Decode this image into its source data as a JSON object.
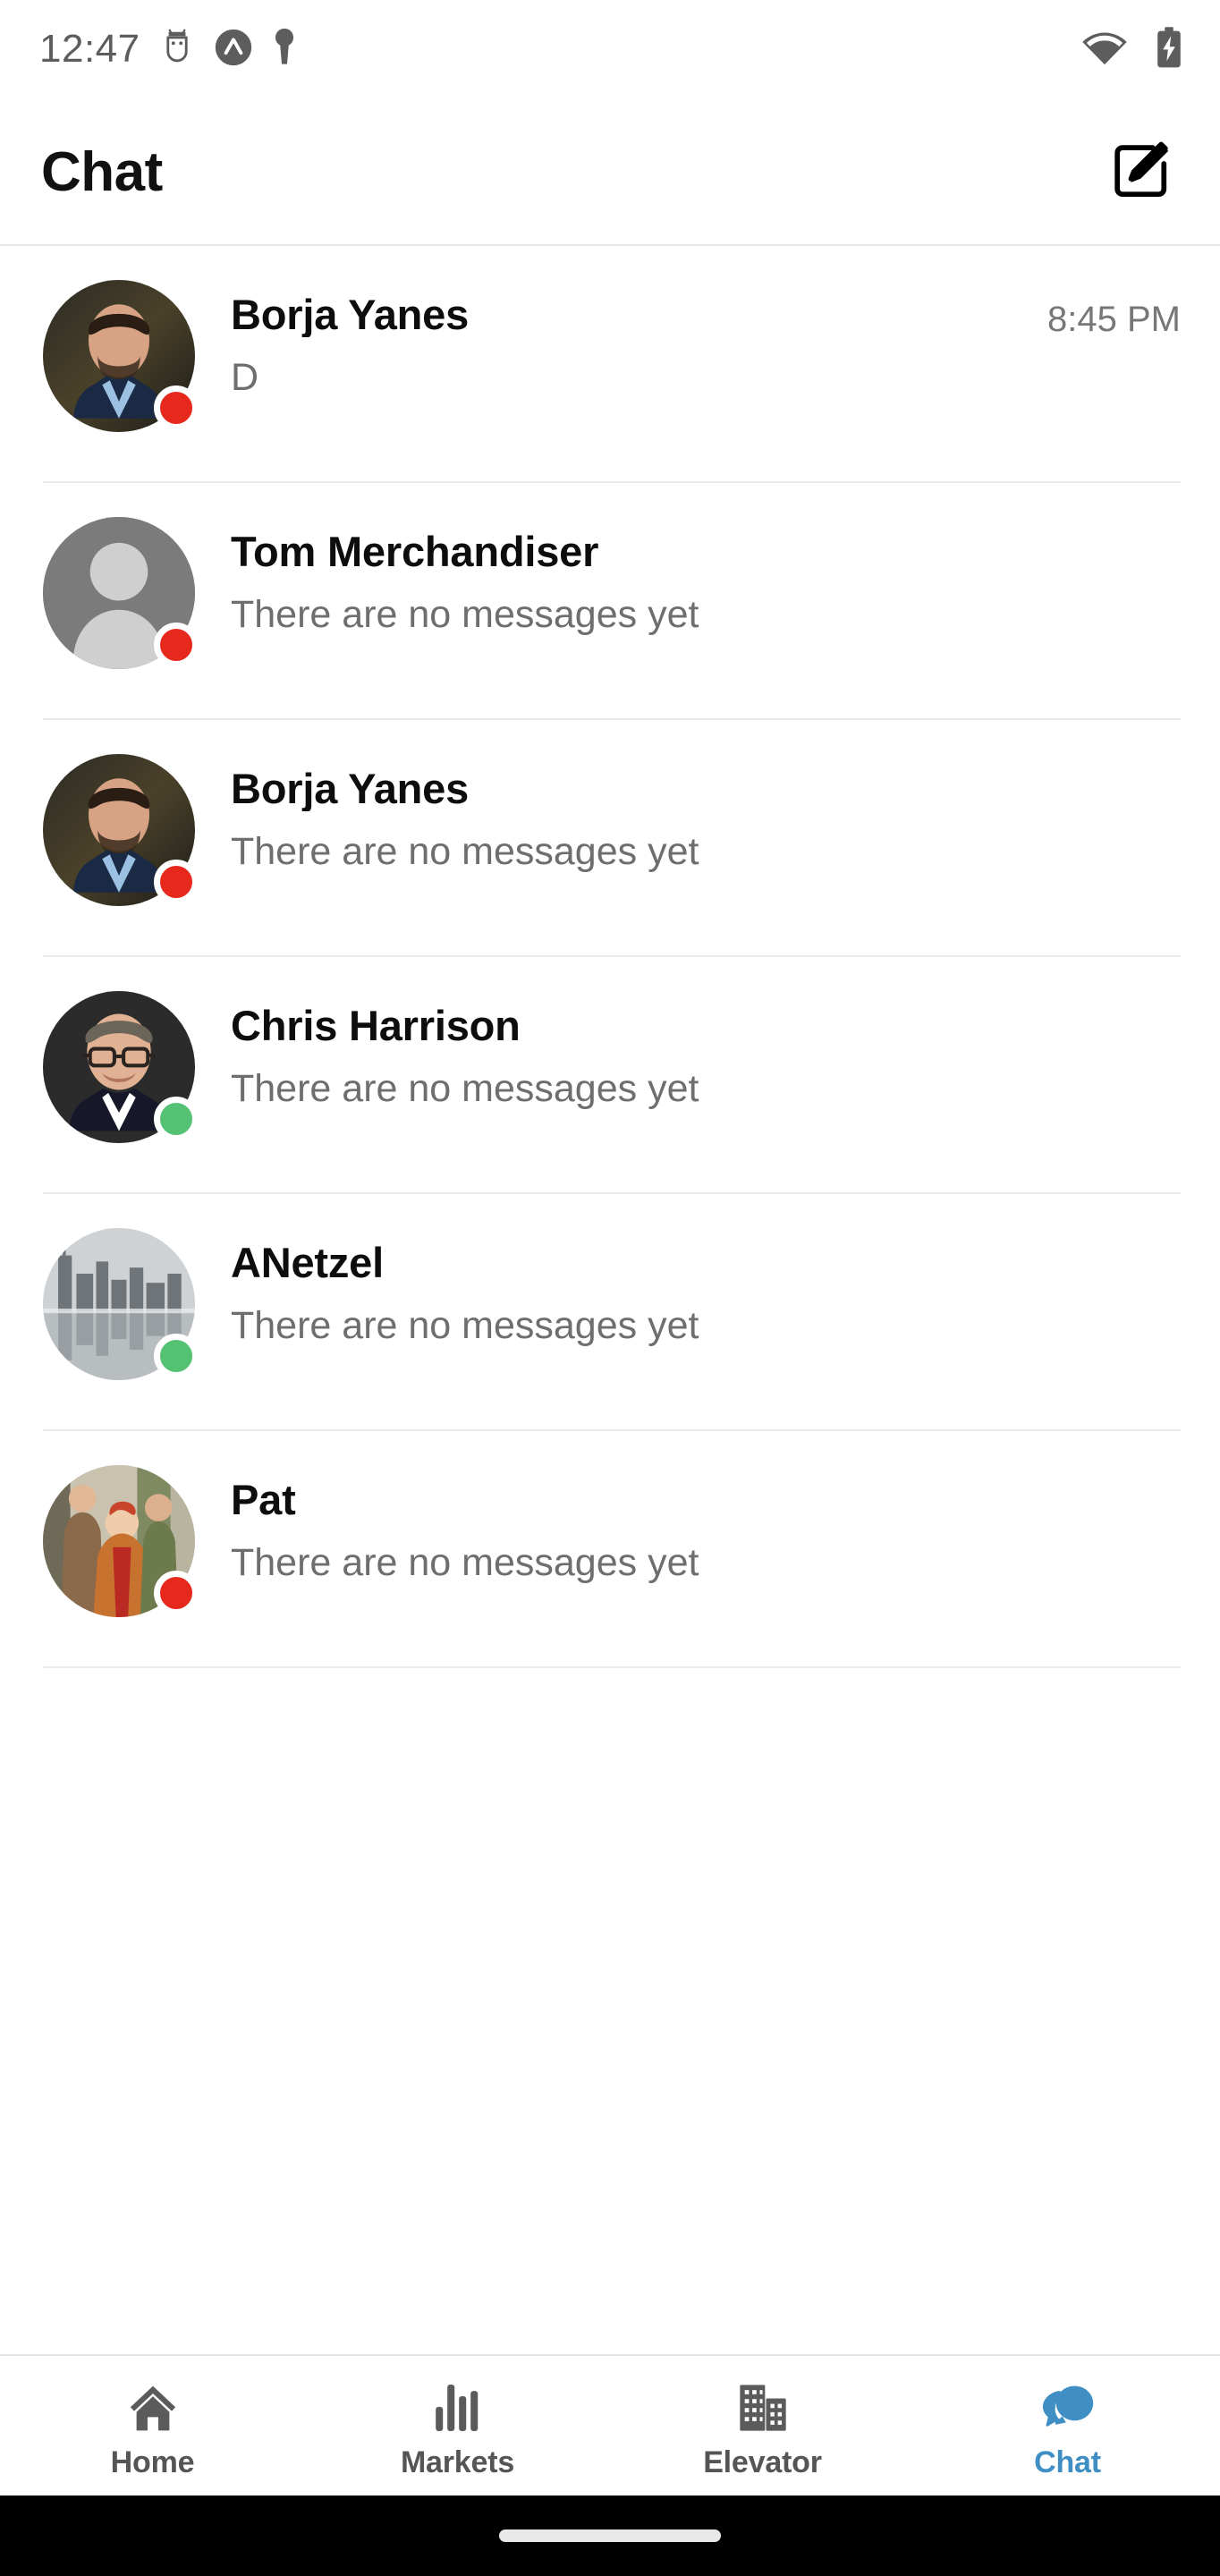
{
  "status_bar": {
    "time": "12:47",
    "left_icons": [
      "android-debug-icon",
      "app-badge-icon",
      "key-icon"
    ],
    "right_icons": [
      "wifi-icon",
      "battery-charging-icon"
    ]
  },
  "header": {
    "title": "Chat",
    "compose_icon": "compose-icon"
  },
  "colors": {
    "accent": "#3f8fc4",
    "status_online": "#55c173",
    "status_offline": "#e6291c",
    "divider": "#e9e9e9",
    "text_primary": "#0d0d0d",
    "text_secondary": "#6e6e6e"
  },
  "chats": [
    {
      "name": "Borja Yanes",
      "preview": "D",
      "time": "8:45 PM",
      "presence": "offline",
      "avatar_type": "photo-man-beard"
    },
    {
      "name": "Tom Merchandiser",
      "preview": "There are no messages yet",
      "time": "",
      "presence": "offline",
      "avatar_type": "placeholder-person"
    },
    {
      "name": "Borja Yanes",
      "preview": "There are no messages yet",
      "time": "",
      "presence": "offline",
      "avatar_type": "photo-man-beard"
    },
    {
      "name": "Chris Harrison",
      "preview": "There are no messages yet",
      "time": "",
      "presence": "online",
      "avatar_type": "photo-man-glasses"
    },
    {
      "name": " ANetzel",
      "preview": "There are no messages yet",
      "time": "",
      "presence": "online",
      "avatar_type": "photo-city-skyline"
    },
    {
      "name": "Pat",
      "preview": "There are no messages yet",
      "time": "",
      "presence": "offline",
      "avatar_type": "photo-group-people"
    }
  ],
  "bottom_nav": {
    "items": [
      {
        "label": "Home",
        "icon": "home-icon",
        "active": false
      },
      {
        "label": "Markets",
        "icon": "bar-chart-icon",
        "active": false
      },
      {
        "label": "Elevator",
        "icon": "building-icon",
        "active": false
      },
      {
        "label": "Chat",
        "icon": "chat-bubble-icon",
        "active": true
      }
    ]
  }
}
